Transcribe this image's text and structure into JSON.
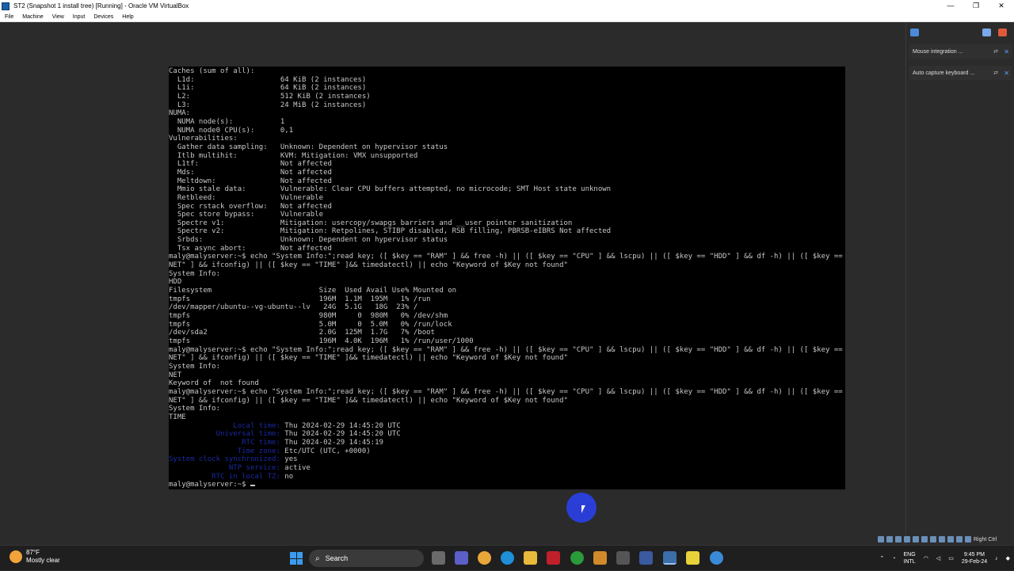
{
  "window": {
    "title": "ST2 (Snapshot 1 install tree) [Running] - Oracle VM VirtualBox",
    "minimize": "—",
    "maximize": "❐",
    "close": "✕"
  },
  "menu": [
    "File",
    "Machine",
    "View",
    "Input",
    "Devices",
    "Help"
  ],
  "terminal": {
    "lines": [
      "Caches (sum of all):",
      "  L1d:                    64 KiB (2 instances)",
      "  L1i:                    64 KiB (2 instances)",
      "  L2:                     512 KiB (2 instances)",
      "  L3:                     24 MiB (2 instances)",
      "NUMA:",
      "  NUMA node(s):           1",
      "  NUMA node0 CPU(s):      0,1",
      "Vulnerabilities:",
      "  Gather data sampling:   Unknown: Dependent on hypervisor status",
      "  Itlb multihit:          KVM: Mitigation: VMX unsupported",
      "  L1tf:                   Not affected",
      "  Mds:                    Not affected",
      "  Meltdown:               Not affected",
      "  Mmio stale data:        Vulnerable: Clear CPU buffers attempted, no microcode; SMT Host state unknown",
      "  Retbleed:               Vulnerable",
      "  Spec rstack overflow:   Not affected",
      "  Spec store bypass:      Vulnerable",
      "  Spectre v1:             Mitigation: usercopy/swapgs barriers and __user pointer sanitization",
      "  Spectre v2:             Mitigation: Retpolines, STIBP disabled, RSB filling, PBRSB-eIBRS Not affected",
      "  Srbds:                  Unknown: Dependent on hypervisor status",
      "  Tsx async abort:        Not affected",
      "maly@malyserver:~$ echo \"System Info:\";read key; ([ $key == \"RAM\" ] && free -h) || ([ $key == \"CPU\" ] && lscpu) || ([ $key == \"HDD\" ] && df -h) || ([ $key == \"",
      "NET\" ] && ifconfig) || ([ $key == \"TIME\" ]&& timedatectl) || echo \"Keyword of $Key not found\"",
      "System Info:",
      "HDD",
      "Filesystem                         Size  Used Avail Use% Mounted on",
      "tmpfs                              196M  1.1M  195M   1% /run",
      "/dev/mapper/ubuntu--vg-ubuntu--lv   24G  5.1G   18G  23% /",
      "tmpfs                              980M     0  980M   0% /dev/shm",
      "tmpfs                              5.0M     0  5.0M   0% /run/lock",
      "/dev/sda2                          2.0G  125M  1.7G   7% /boot",
      "tmpfs                              196M  4.0K  196M   1% /run/user/1000",
      "maly@malyserver:~$ echo \"System Info:\";read key; ([ $key == \"RAM\" ] && free -h) || ([ $key == \"CPU\" ] && lscpu) || ([ $key == \"HDD\" ] && df -h) || ([ $key == \"",
      "NET\" ] && ifconfig) || ([ $key == \"TIME\" ]&& timedatectl) || echo \"Keyword of $Key not found\"",
      "System Info:",
      "NET",
      "Keyword of  not found",
      "maly@malyserver:~$ echo \"System Info:\";read key; ([ $key == \"RAM\" ] && free -h) || ([ $key == \"CPU\" ] && lscpu) || ([ $key == \"HDD\" ] && df -h) || ([ $key == \"",
      "NET\" ] && ifconfig) || ([ $key == \"TIME\" ]&& timedatectl) || echo \"Keyword of $Key not found\"",
      "System Info:",
      "TIME"
    ],
    "timedatectl": [
      {
        "label": "               Local time:",
        "value": " Thu 2024-02-29 14:45:20 UTC"
      },
      {
        "label": "           Universal time:",
        "value": " Thu 2024-02-29 14:45:20 UTC"
      },
      {
        "label": "                 RTC time:",
        "value": " Thu 2024-02-29 14:45:19"
      },
      {
        "label": "                Time zone:",
        "value": " Etc/UTC (UTC, +0000)"
      },
      {
        "label": "System clock synchronized:",
        "value": " yes"
      },
      {
        "label": "              NTP service:",
        "value": " active"
      },
      {
        "label": "          RTC in local TZ:",
        "value": " no"
      }
    ],
    "prompt": "maly@malyserver:~$ "
  },
  "side_panel": {
    "notifications": [
      "Mouse integration ...",
      "Auto capture keyboard ..."
    ]
  },
  "status_strip": {
    "host_key": "Right Ctrl"
  },
  "taskbar": {
    "weather_temp": "87°F",
    "weather_desc": "Mostly clear",
    "search_label": "Search",
    "lang_top": "ENG",
    "lang_bottom": "INTL",
    "time": "9:45 PM",
    "date": "29-Feb-24"
  },
  "colors": {
    "terminal_bg": "#000000",
    "terminal_fg": "#c8c8c8",
    "timedatectl_label": "#1a2aa0",
    "cursor_highlight": "#2a40e0"
  }
}
